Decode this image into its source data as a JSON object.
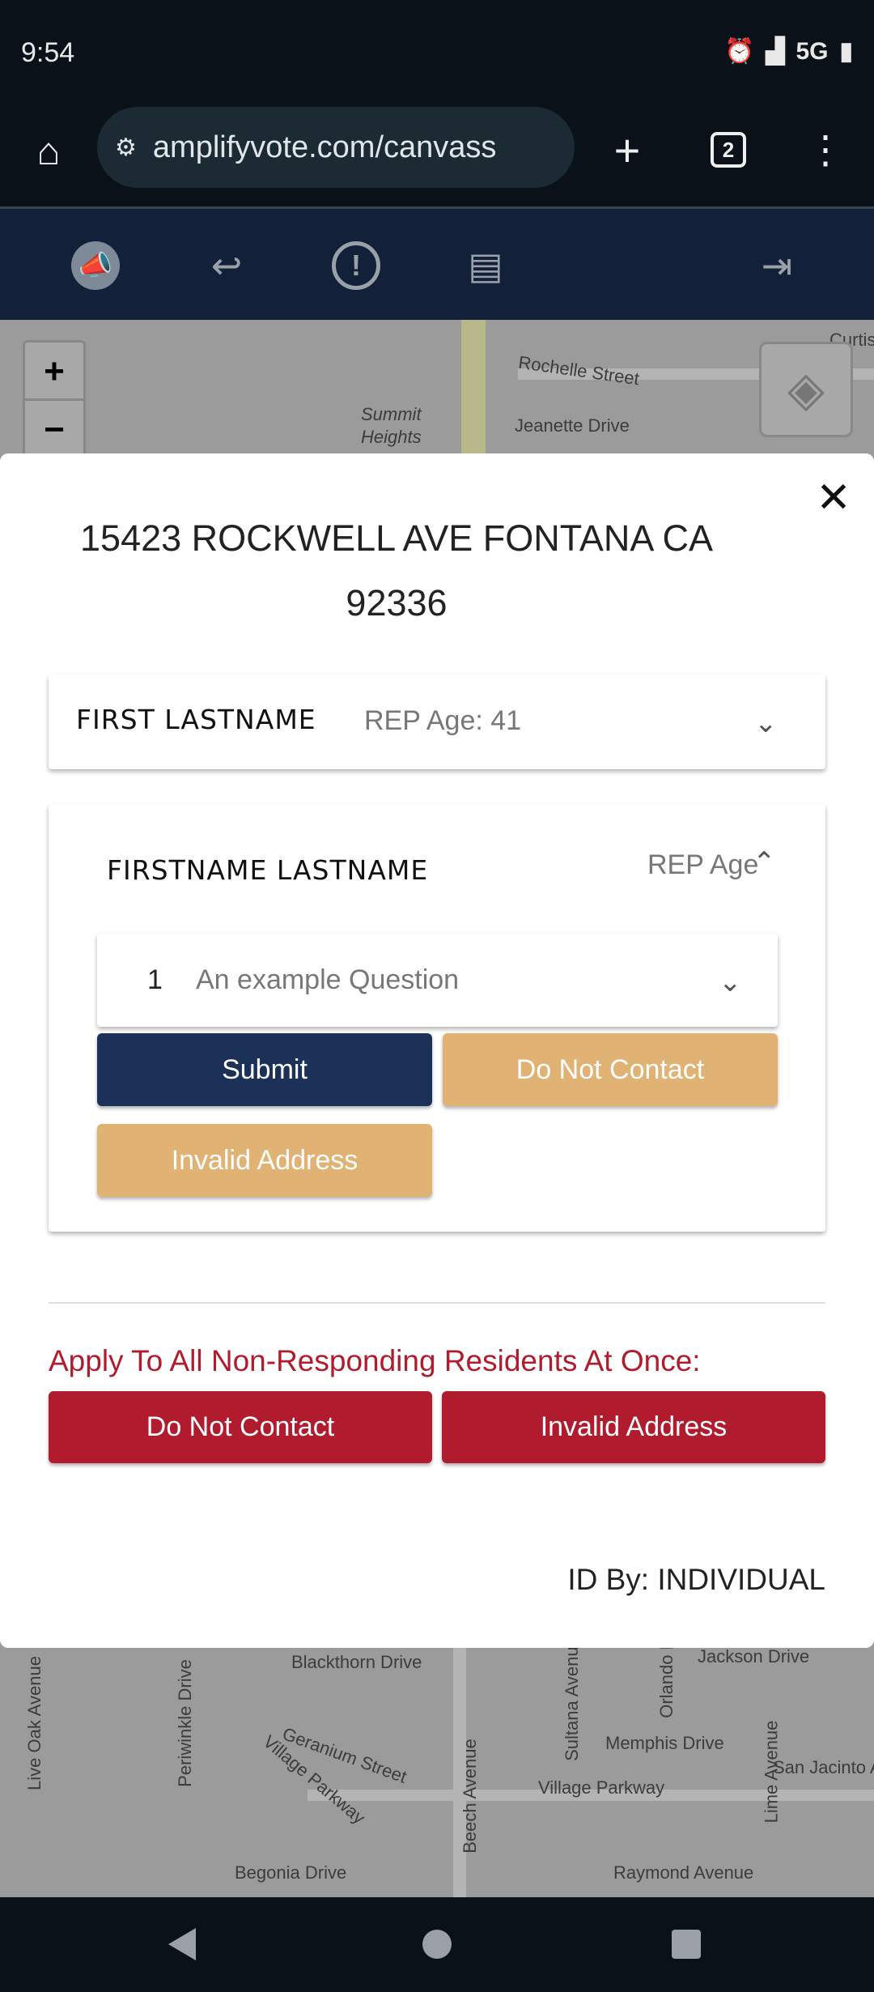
{
  "status": {
    "time": "9:54",
    "network": "5G",
    "icons": [
      "alarm-icon",
      "signal-icon",
      "battery-icon"
    ]
  },
  "browser": {
    "url": "amplifyvote.com/canvass",
    "tab_count": "2"
  },
  "toolbar": {
    "icons": [
      "megaphone-logo",
      "reply-icon",
      "alert-icon",
      "library-icon",
      "logout-icon"
    ]
  },
  "map": {
    "streets_top": [
      "Rochelle Street",
      "Jeanette Drive",
      "Summit",
      "Heights",
      "Curtis"
    ],
    "streets_bottom": [
      "Blackthorn Drive",
      "Jackson Drive",
      "Geranium Street",
      "Memphis Drive",
      "Village Parkway",
      "Village Parkway",
      "San Jacinto A",
      "Begonia Drive",
      "Raymond Avenue",
      "Live Oak Avenue",
      "Periwinkle Drive",
      "Beech Avenue",
      "Sultana Avenue",
      "Lime Avenue",
      "Orlando Dr"
    ],
    "zoom_in": "+",
    "zoom_out": "−"
  },
  "modal": {
    "address_line1": "15423 ROCKWELL AVE FONTANA CA",
    "address_line2": "92336",
    "residents": [
      {
        "name": "FIRST LASTNAME",
        "info": "REP Age: 41",
        "expanded": false
      },
      {
        "name": "FIRSTNAME  LASTNAME",
        "info": "REP Age",
        "expanded": true,
        "question": {
          "number": "1",
          "text": "An example Question"
        },
        "buttons": {
          "submit": "Submit",
          "do_not_contact": "Do Not Contact",
          "invalid_address": "Invalid Address"
        }
      }
    ],
    "apply_all_label": "Apply To All Non-Responding Residents At Once:",
    "apply_all_buttons": {
      "do_not_contact": "Do Not Contact",
      "invalid_address": "Invalid Address"
    },
    "id_by": "ID By: INDIVIDUAL"
  },
  "colors": {
    "navy": "#1b3157",
    "tan": "#e0b273",
    "red": "#b01c2e",
    "apply_text": "#b01c2e"
  }
}
